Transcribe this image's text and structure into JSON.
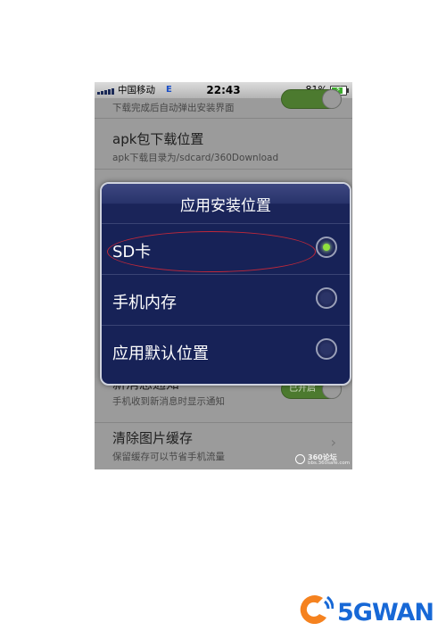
{
  "status_bar": {
    "carrier": "中国移动",
    "network": "E",
    "time": "22:43",
    "battery": "81%",
    "battery_level": 0.81
  },
  "settings": {
    "top_partial_subtitle": "下载完成后自动弹出安装界面",
    "apk_location": {
      "title": "apk包下载位置",
      "subtitle": "apk下载目录为/sdcard/360Download"
    },
    "notifications": {
      "title": "新消息通知",
      "subtitle": "手机收到新消息时显示通知",
      "toggle_label": "已开启"
    },
    "clear_cache": {
      "title": "清除图片缓存",
      "subtitle": "保留缓存可以节省手机流量"
    }
  },
  "dialog": {
    "title": "应用安装位置",
    "options": [
      {
        "label": "SD卡",
        "selected": true
      },
      {
        "label": "手机内存",
        "selected": false
      },
      {
        "label": "应用默认位置",
        "selected": false
      }
    ]
  },
  "watermark": {
    "brand": "360论坛",
    "url": "bbs.360safe.com"
  },
  "logo": {
    "text": "5GWAN",
    "colors": {
      "mark": "#f5821f",
      "text": "#1768d6"
    }
  }
}
